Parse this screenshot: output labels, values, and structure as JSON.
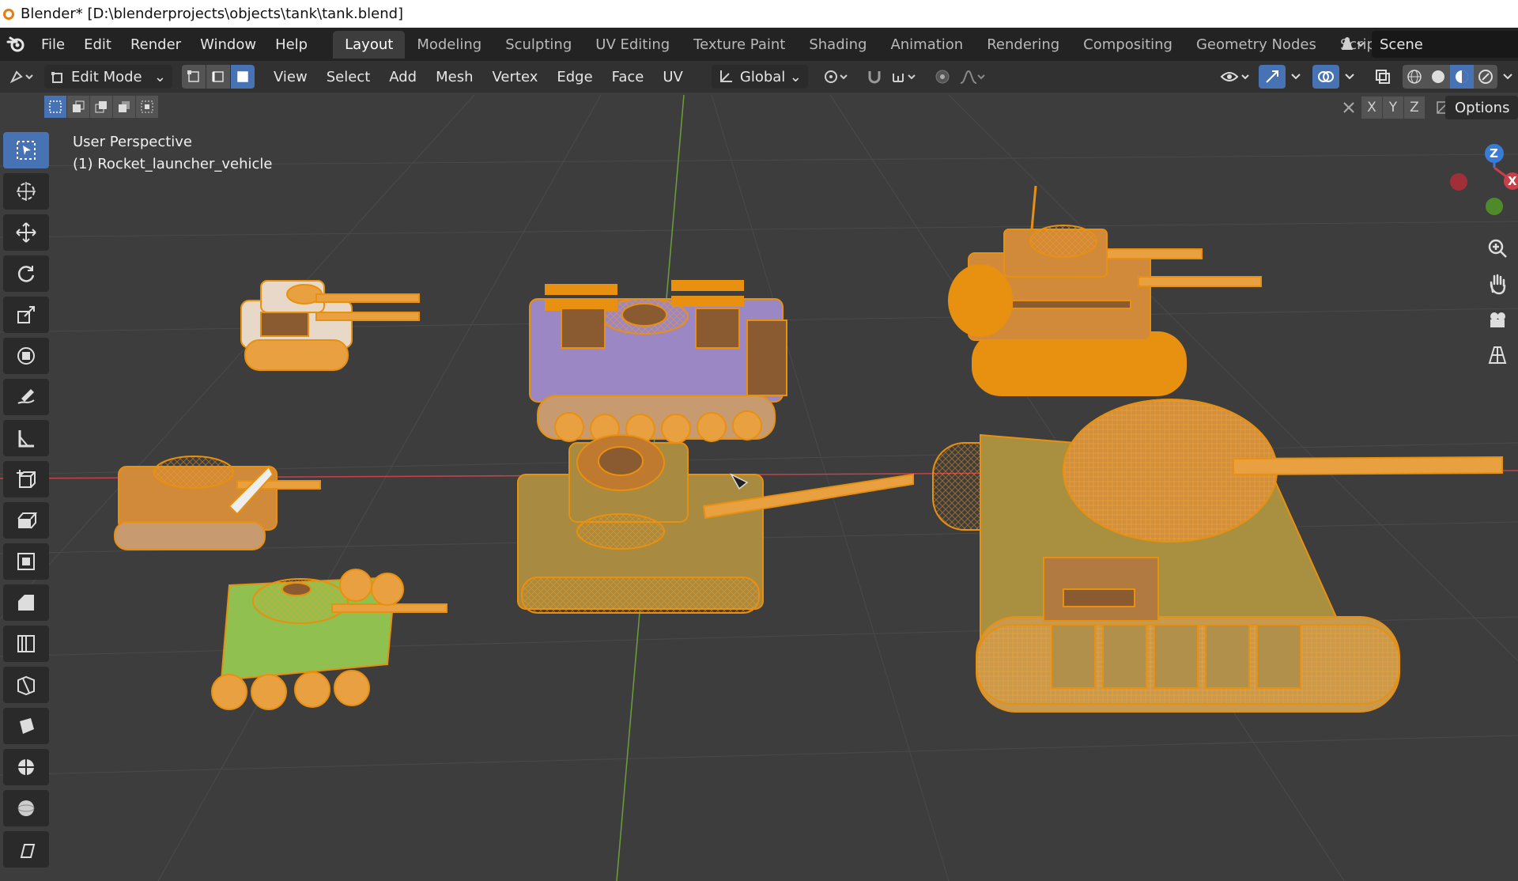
{
  "window": {
    "title": "Blender* [D:\\blenderprojects\\objects\\tank\\tank.blend]"
  },
  "menu": {
    "items": [
      "File",
      "Edit",
      "Render",
      "Window",
      "Help"
    ]
  },
  "workspaces": {
    "tabs": [
      "Layout",
      "Modeling",
      "Sculpting",
      "UV Editing",
      "Texture Paint",
      "Shading",
      "Animation",
      "Rendering",
      "Compositing",
      "Geometry Nodes",
      "Scripting"
    ],
    "active": "Layout",
    "add_label": "+"
  },
  "scene": {
    "name": "Scene"
  },
  "viewport_header": {
    "mode": "Edit Mode",
    "menus": [
      "View",
      "Select",
      "Add",
      "Mesh",
      "Vertex",
      "Edge",
      "Face",
      "UV"
    ],
    "transform_orientation": "Global"
  },
  "subheader": {
    "axes": [
      "X",
      "Y",
      "Z"
    ],
    "options_label": "Options"
  },
  "viewport": {
    "view_name": "User Perspective",
    "object_name": "(1) Rocket_launcher_vehicle"
  },
  "gizmo": {
    "z": "Z",
    "x": "X"
  },
  "colors": {
    "accent": "#4772b3",
    "selection_orange": "#e8900f",
    "background": "#3d3d3d",
    "axis_red": "#c8404a",
    "axis_green": "#6a9e3a"
  }
}
